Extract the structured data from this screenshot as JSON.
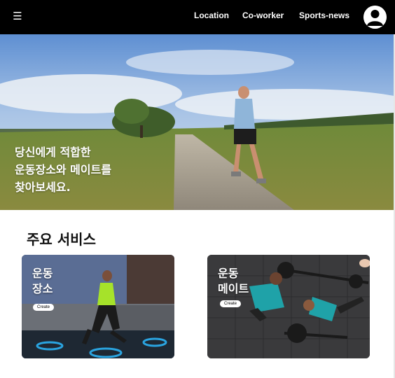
{
  "nav": {
    "menu_icon": "hamburger-icon",
    "links": [
      "Location",
      "Co-worker",
      "Sports-news"
    ],
    "avatar_icon": "user-avatar-icon"
  },
  "hero": {
    "lines": [
      "당신에게 적합한",
      "운동장소와 메이트를",
      "찾아보세요."
    ]
  },
  "section": {
    "title": "주요 서비스"
  },
  "cards": [
    {
      "title_lines": [
        "운동",
        "장소"
      ],
      "button": "Create"
    },
    {
      "title_lines": [
        "운동",
        "메이트"
      ],
      "button": "Create"
    }
  ],
  "colors": {
    "nav_bg": "#000000",
    "text_light": "#ffffff",
    "title_dark": "#111111"
  }
}
